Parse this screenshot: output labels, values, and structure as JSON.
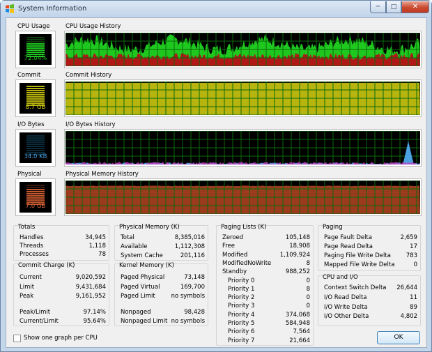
{
  "window": {
    "title": "System Information",
    "minimize": "─",
    "maximize": "□",
    "close": "✕"
  },
  "colors": {
    "cpu_green": "#1fc81f",
    "cpu_red": "#b01818",
    "commit_olive": "#b8b40f",
    "io_blue": "#4aa0e0",
    "io_magenta": "#c040c0",
    "physical_red": "#9a3b1e",
    "grid": "#0a6a0a"
  },
  "graphs": {
    "cpu": {
      "label": "CPU Usage",
      "value": "72.04%",
      "history_label": "CPU Usage History",
      "level": 0.72
    },
    "commit": {
      "label": "Commit",
      "value": "8.7 GB",
      "history_label": "Commit History",
      "level": 0.96
    },
    "io": {
      "label": "I/O Bytes",
      "value": "34.0  KB",
      "history_label": "I/O Bytes History",
      "level": 0.02
    },
    "physical": {
      "label": "Physical",
      "value": "7.0 GB",
      "history_label": "Physical Memory History",
      "level": 0.84
    }
  },
  "totals": {
    "title": "Totals",
    "rows": [
      {
        "k": "Handles",
        "v": "34,945"
      },
      {
        "k": "Threads",
        "v": "1,118"
      },
      {
        "k": "Processes",
        "v": "78"
      }
    ]
  },
  "commit_charge": {
    "title": "Commit Charge (K)",
    "rows": [
      {
        "k": "Current",
        "v": "9,020,592"
      },
      {
        "k": "Limit",
        "v": "9,431,684"
      },
      {
        "k": "Peak",
        "v": "9,161,952"
      },
      {
        "k": "Peak/Limit",
        "v": "97.14%"
      },
      {
        "k": "Current/Limit",
        "v": "95.64%"
      }
    ]
  },
  "physical_memory": {
    "title": "Physical Memory (K)",
    "rows": [
      {
        "k": "Total",
        "v": "8,385,016"
      },
      {
        "k": "Available",
        "v": "1,112,308"
      },
      {
        "k": "System Cache",
        "v": "201,116"
      }
    ]
  },
  "kernel_memory": {
    "title": "Kernel Memory (K)",
    "rows": [
      {
        "k": "Paged Physical",
        "v": "73,148"
      },
      {
        "k": "Paged Virtual",
        "v": "169,700"
      },
      {
        "k": "Paged Limit",
        "v": "no symbols"
      },
      {
        "k": "Nonpaged",
        "v": "98,428"
      },
      {
        "k": "Nonpaged Limit",
        "v": "no symbols"
      }
    ]
  },
  "paging_lists": {
    "title": "Paging Lists (K)",
    "rows": [
      {
        "k": "Zeroed",
        "v": "105,148"
      },
      {
        "k": "Free",
        "v": "18,908"
      },
      {
        "k": "Modified",
        "v": "1,109,924"
      },
      {
        "k": "ModifiedNoWrite",
        "v": "8"
      },
      {
        "k": "Standby",
        "v": "988,252"
      },
      {
        "k": "Priority 0",
        "v": "0"
      },
      {
        "k": "Priority 1",
        "v": "8"
      },
      {
        "k": "Priority 2",
        "v": "0"
      },
      {
        "k": "Priority 3",
        "v": "0"
      },
      {
        "k": "Priority 4",
        "v": "374,068"
      },
      {
        "k": "Priority 5",
        "v": "584,948"
      },
      {
        "k": "Priority 6",
        "v": "7,564"
      },
      {
        "k": "Priority 7",
        "v": "21,664"
      }
    ]
  },
  "paging": {
    "title": "Paging",
    "rows": [
      {
        "k": "Page Fault Delta",
        "v": "2,659"
      },
      {
        "k": "Page Read Delta",
        "v": "17"
      },
      {
        "k": "Paging File Write Delta",
        "v": "783"
      },
      {
        "k": "Mapped File Write Delta",
        "v": "0"
      }
    ]
  },
  "cpu_io": {
    "title": "CPU and I/O",
    "rows": [
      {
        "k": "Context Switch Delta",
        "v": "26,644"
      },
      {
        "k": "I/O Read Delta",
        "v": "11"
      },
      {
        "k": "I/O Write Delta",
        "v": "89"
      },
      {
        "k": "I/O Other Delta",
        "v": "4,802"
      }
    ]
  },
  "footer": {
    "checkbox_label": "Show one graph per CPU",
    "ok_label": "OK"
  }
}
